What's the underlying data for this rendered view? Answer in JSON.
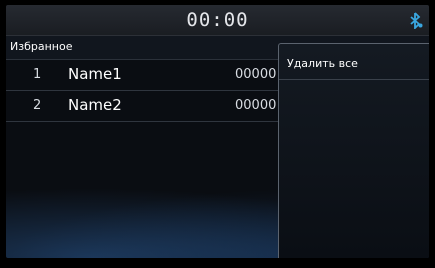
{
  "status": {
    "time": "00:00",
    "bluetooth_icon": "bluetooth-icon",
    "accent_color": "#3aa7e0"
  },
  "header": {
    "title": "Избранное"
  },
  "favorites": [
    {
      "index": "1",
      "name": "Name1",
      "number": "00000"
    },
    {
      "index": "2",
      "name": "Name2",
      "number": "00000"
    }
  ],
  "menu": {
    "delete_all": "Удалить все"
  }
}
